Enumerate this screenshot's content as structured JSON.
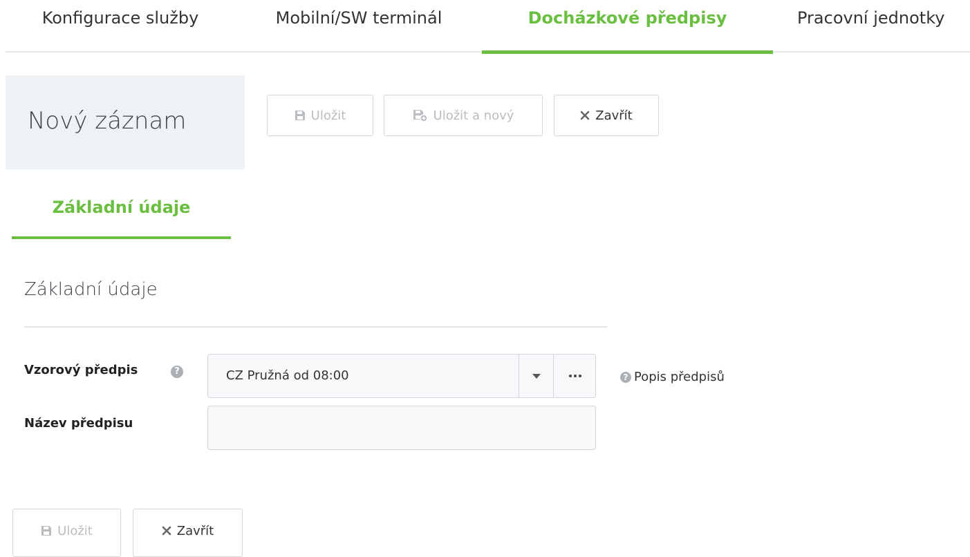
{
  "top_tabs": [
    {
      "label": "Konfigurace služby",
      "active": false
    },
    {
      "label": "Mobilní/SW terminál",
      "active": false
    },
    {
      "label": "Docházkové předpisy",
      "active": true
    },
    {
      "label": "Pracovní jednotky",
      "active": false
    }
  ],
  "header": {
    "title": "Nový záznam",
    "save_label": "Uložit",
    "save_new_label": "Uložit a nový",
    "close_label": "Zavřít"
  },
  "sub_tab": {
    "label": "Základní údaje"
  },
  "section": {
    "title": "Základní údaje",
    "template_label": "Vzorový předpis",
    "template_value": "CZ Pružná od 08:00",
    "name_label": "Název předpisu",
    "name_value": "",
    "help_link_label": "Popis předpisů"
  },
  "footer": {
    "save_label": "Uložit",
    "close_label": "Zavřít"
  },
  "colors": {
    "accent": "#6abf40",
    "panel_bg": "#eef1f5",
    "border": "#d3d6da"
  }
}
